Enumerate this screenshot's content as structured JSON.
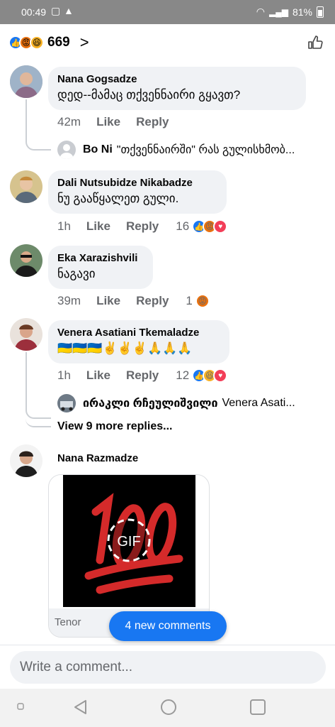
{
  "status_bar": {
    "time": "00:49",
    "battery": "81%"
  },
  "header": {
    "count": "669"
  },
  "comments": [
    {
      "name": "Nana Gogsadze",
      "text": "დედ--მამაც თქვენნაირი გყავთ?",
      "time": "42m",
      "like": "Like",
      "reply": "Reply",
      "replies": [
        {
          "name": "Bo Ni",
          "text": "\"თქვენნაირში\" რას გულისხმობ..."
        }
      ]
    },
    {
      "name": "Dali Nutsubidze Nikabadze",
      "text": "ნუ გააწყალეთ გული.",
      "time": "1h",
      "like": "Like",
      "reply": "Reply",
      "reaction_count": "16"
    },
    {
      "name": "Eka Xarazishvili",
      "text": "ნაგავი",
      "time": "39m",
      "like": "Like",
      "reply": "Reply",
      "reaction_count": "1"
    },
    {
      "name": "Venera Asatiani Tkemaladze",
      "text": "🇺🇦🇺🇦🇺🇦✌️✌️✌️🙏🙏🙏",
      "time": "1h",
      "like": "Like",
      "reply": "Reply",
      "reaction_count": "12",
      "replies": [
        {
          "name": "ირაკლი რჩეულიშვილი",
          "text": "Venera Asati..."
        }
      ],
      "more_replies": "View 9 more replies..."
    },
    {
      "name": "Nana Razmadze",
      "gif_badge": "GIF",
      "gif_source": "Tenor"
    }
  ],
  "new_comments_label": "4 new comments",
  "composer_placeholder": "Write a comment...",
  "icons": {
    "like_reaction": "thumbs-up",
    "angry_reaction": "angry-face",
    "haha_reaction": "laughing-face",
    "love_reaction": "heart",
    "colors": {
      "like": "#1877f2",
      "angry": "#e9710f",
      "haha": "#f7b125",
      "love": "#f33e58"
    }
  }
}
